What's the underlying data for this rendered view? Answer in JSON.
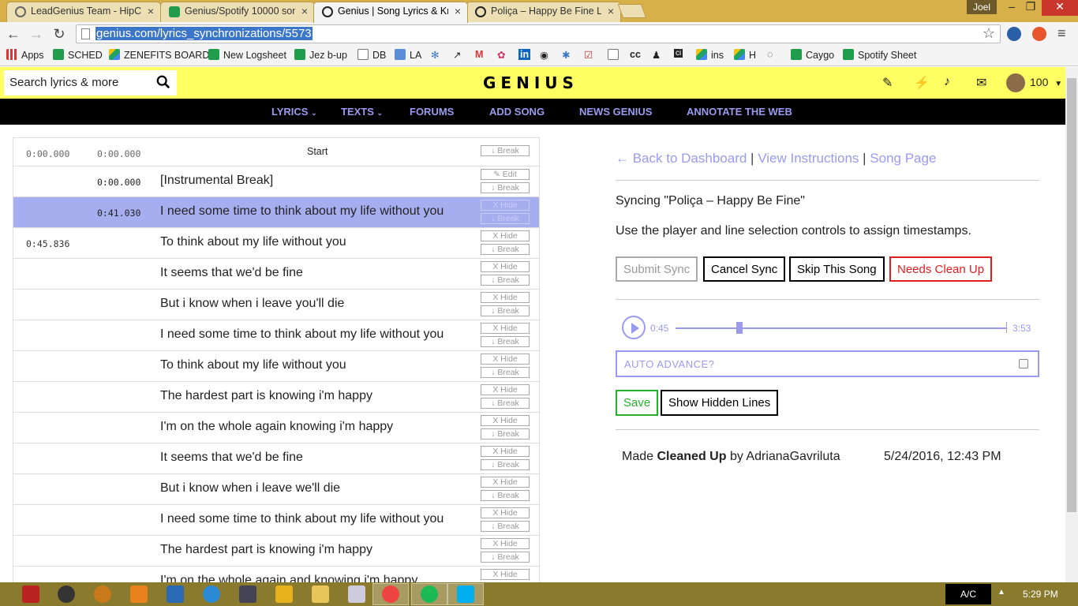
{
  "browser": {
    "tabs": [
      {
        "title": "LeadGenius Team - HipCh",
        "icon_color": "#7a7a7a"
      },
      {
        "title": "Genius/Spotify 10000 son",
        "icon_color": "#1f9c4c"
      },
      {
        "title": "Genius | Song Lyrics & Kn",
        "icon_color": "#222222"
      },
      {
        "title": "Poliça – Happy Be Fine Ly",
        "icon_color": "#222222"
      }
    ],
    "user": "Joel",
    "url": "genius.com/lyrics_synchronizations/5573",
    "bookmarks": [
      {
        "label": "Apps",
        "icon": "apps-grid-icon"
      },
      {
        "label": "SCHED",
        "icon": "sheet-icon"
      },
      {
        "label": "ZENEFITS BOARD",
        "icon": "drive-icon"
      },
      {
        "label": "New Logsheet",
        "icon": "sheet-icon"
      },
      {
        "label": "Jez b-up",
        "icon": "sheet-icon"
      },
      {
        "label": "DB",
        "icon": "doc-icon"
      },
      {
        "label": "LA",
        "icon": "doc-icon"
      },
      {
        "label": "ins",
        "icon": "drive-icon"
      },
      {
        "label": "H",
        "icon": "drive-icon"
      },
      {
        "label": "Caygo",
        "icon": "sheet-icon"
      },
      {
        "label": "Spotify Sheet",
        "icon": "sheet-icon"
      }
    ]
  },
  "genius": {
    "search_placeholder": "Search lyrics & more",
    "logo": "GENIUS",
    "iq": "100",
    "nav": [
      "LYRICS",
      "TEXTS",
      "FORUMS",
      "ADD SONG",
      "NEWS GENIUS",
      "ANNOTATE THE WEB"
    ],
    "accent": "#9a9bef",
    "header_bg": "#ffff64"
  },
  "lyrics_table": {
    "start_row": {
      "ts1": "0:00.000",
      "ts2": "0:00.000",
      "label": "Start",
      "break": "↓ Break"
    },
    "rows": [
      {
        "ts1": "",
        "ts2": "0:00.000",
        "text": "[Instrumental Break]",
        "top_btn": "✎ Edit",
        "bot_btn": "↓ Break",
        "selected": false
      },
      {
        "ts1": "",
        "ts2": "0:41.030",
        "text": "I need some time to think about my life without you",
        "top_btn": "X Hide",
        "bot_btn": "↓ Break",
        "selected": true
      },
      {
        "ts1": "0:45.836",
        "ts2": "",
        "text": "To think about my life without you",
        "top_btn": "X Hide",
        "bot_btn": "↓ Break",
        "selected": false
      },
      {
        "ts1": "",
        "ts2": "",
        "text": "It seems that we'd be fine",
        "top_btn": "X Hide",
        "bot_btn": "↓ Break",
        "selected": false
      },
      {
        "ts1": "",
        "ts2": "",
        "text": "But i know when i leave you'll die",
        "top_btn": "X Hide",
        "bot_btn": "↓ Break",
        "selected": false
      },
      {
        "ts1": "",
        "ts2": "",
        "text": "I need some time to think about my life without you",
        "top_btn": "X Hide",
        "bot_btn": "↓ Break",
        "selected": false
      },
      {
        "ts1": "",
        "ts2": "",
        "text": "To think about my life without you",
        "top_btn": "X Hide",
        "bot_btn": "↓ Break",
        "selected": false
      },
      {
        "ts1": "",
        "ts2": "",
        "text": "The hardest part is knowing i'm happy",
        "top_btn": "X Hide",
        "bot_btn": "↓ Break",
        "selected": false
      },
      {
        "ts1": "",
        "ts2": "",
        "text": "I'm on the whole again knowing i'm happy",
        "top_btn": "X Hide",
        "bot_btn": "↓ Break",
        "selected": false
      },
      {
        "ts1": "",
        "ts2": "",
        "text": "It seems that we'd be fine",
        "top_btn": "X Hide",
        "bot_btn": "↓ Break",
        "selected": false
      },
      {
        "ts1": "",
        "ts2": "",
        "text": "But i know when i leave we'll die",
        "top_btn": "X Hide",
        "bot_btn": "↓ Break",
        "selected": false
      },
      {
        "ts1": "",
        "ts2": "",
        "text": "I need some time to think about my life without you",
        "top_btn": "X Hide",
        "bot_btn": "↓ Break",
        "selected": false
      },
      {
        "ts1": "",
        "ts2": "",
        "text": "The hardest part is knowing i'm happy",
        "top_btn": "X Hide",
        "bot_btn": "↓ Break",
        "selected": false
      },
      {
        "ts1": "",
        "ts2": "",
        "text": "I'm on the whole again and knowing i'm happy",
        "top_btn": "X Hide",
        "bot_btn": "↓ Break",
        "selected": false
      }
    ]
  },
  "sync_panel": {
    "back_link": "← Back to Dashboard",
    "instructions_link": "View Instructions",
    "song_link": "Song Page",
    "separator": "|",
    "syncing": "Syncing \"Poliça – Happy Be Fine\"",
    "instructions": "Use the player and line selection controls to assign timestamps.",
    "buttons": {
      "submit": "Submit Sync",
      "cancel": "Cancel Sync",
      "skip": "Skip This Song",
      "clean": "Needs Clean Up"
    },
    "player": {
      "current": "0:45",
      "duration": "3:53",
      "progress": 0.193
    },
    "auto_advance": "AUTO ADVANCE?",
    "auto_advance_checked": false,
    "save": "Save",
    "show_hidden": "Show Hidden Lines",
    "history": {
      "prefix": "Made",
      "status": "Cleaned Up",
      "by": "by AdrianaGavriluta",
      "date": "5/24/2016, 12:43 PM"
    }
  },
  "taskbar": {
    "input_indicator": "A/C",
    "clock": "5:29 PM"
  }
}
